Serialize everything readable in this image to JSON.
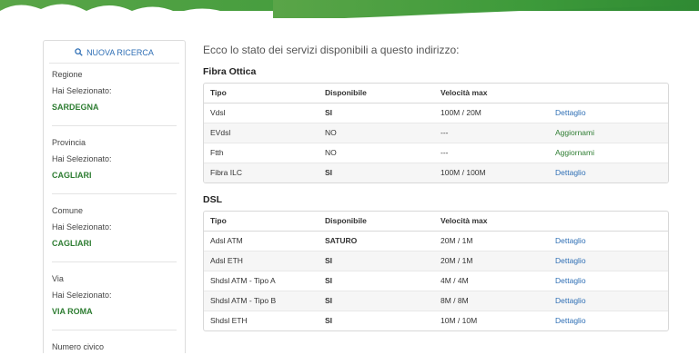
{
  "sidebar": {
    "search_label": "NUOVA RICERCA",
    "blocks": [
      {
        "label": "Regione",
        "selected_label": "Hai Selezionato:",
        "value": "SARDEGNA"
      },
      {
        "label": "Provincia",
        "selected_label": "Hai Selezionato:",
        "value": "CAGLIARI"
      },
      {
        "label": "Comune",
        "selected_label": "Hai Selezionato:",
        "value": "CAGLIARI"
      },
      {
        "label": "Via",
        "selected_label": "Hai Selezionato:",
        "value": "VIA ROMA"
      },
      {
        "label": "Numero civico"
      }
    ]
  },
  "main": {
    "intro": "Ecco lo stato dei servizi disponibili a questo indirizzo:",
    "sections": [
      {
        "title": "Fibra Ottica",
        "headers": [
          "Tipo",
          "Disponibile",
          "Velocità max"
        ],
        "rows": [
          {
            "tipo": "Vdsl",
            "disp": "SI",
            "vel": "100M / 20M",
            "action": "Dettaglio"
          },
          {
            "tipo": "EVdsl",
            "disp": "NO",
            "vel": "---",
            "action": "Aggiornami"
          },
          {
            "tipo": "Ftth",
            "disp": "NO",
            "vel": "---",
            "action": "Aggiornami"
          },
          {
            "tipo": "Fibra ILC",
            "disp": "SI",
            "vel": "100M / 100M",
            "action": "Dettaglio"
          }
        ]
      },
      {
        "title": "DSL",
        "headers": [
          "Tipo",
          "Disponibile",
          "Velocità max"
        ],
        "rows": [
          {
            "tipo": "Adsl ATM",
            "disp": "SATURO",
            "vel": "20M / 1M",
            "action": "Dettaglio"
          },
          {
            "tipo": "Adsl ETH",
            "disp": "SI",
            "vel": "20M / 1M",
            "action": "Dettaglio"
          },
          {
            "tipo": "Shdsl ATM - Tipo A",
            "disp": "SI",
            "vel": "4M / 4M",
            "action": "Dettaglio"
          },
          {
            "tipo": "Shdsl ATM - Tipo B",
            "disp": "SI",
            "vel": "8M / 8M",
            "action": "Dettaglio"
          },
          {
            "tipo": "Shdsl ETH",
            "disp": "SI",
            "vel": "10M / 10M",
            "action": "Dettaglio"
          }
        ]
      }
    ]
  },
  "colors": {
    "accent_link": "#2f6fb5",
    "accent_green": "#2e7d32",
    "banner_green": "#3d9a3a"
  }
}
